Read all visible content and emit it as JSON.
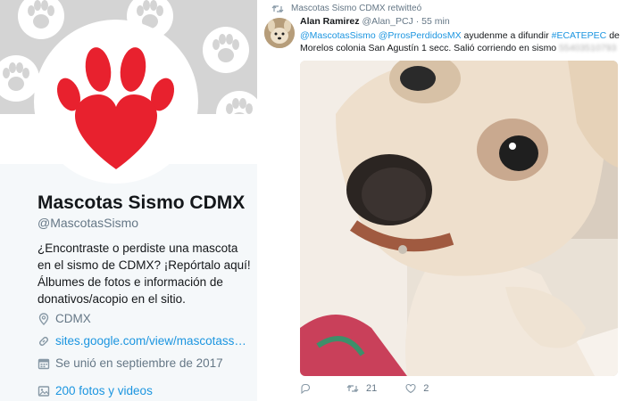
{
  "profile": {
    "name": "Mascotas Sismo CDMX",
    "handle": "@MascotasSismo",
    "bio": "¿Encontraste o perdiste una mascota en el sismo de CDMX? ¡Repórtalo aquí! Álbumes de fotos e información de donativos/acopio en el sitio.",
    "location": "CDMX",
    "website": "sites.google.com/view/mascotass…",
    "joined": "Se unió en septiembre de 2017",
    "media_count": "200 fotos y videos",
    "icons": [
      "location-icon",
      "link-icon",
      "calendar-icon",
      "image-icon"
    ],
    "colors": {
      "accent": "#1b95e0",
      "avatar_paw": "#e8212e"
    }
  },
  "tweet": {
    "retweet_label": "Mascotas Sismo CDMX retwitteó",
    "author_name": "Alan Ramirez",
    "author_handle": "@Alan_PCJ",
    "time": "· 55 min",
    "text": {
      "mention1": "@MascotasSismo",
      "mention2": "@PrrosPerdidosMX",
      "part1": " ayudenme a difundir ",
      "hashtag": "#ECATEPEC",
      "part2": " de Morelos colonia San Agustín 1 secc. Salió corriendo en sismo ",
      "redacted": "55403510793"
    },
    "reply_count": "",
    "retweet_count": "21",
    "like_count": "2",
    "icons": [
      "retweet-icon",
      "reply-icon",
      "like-icon"
    ]
  }
}
